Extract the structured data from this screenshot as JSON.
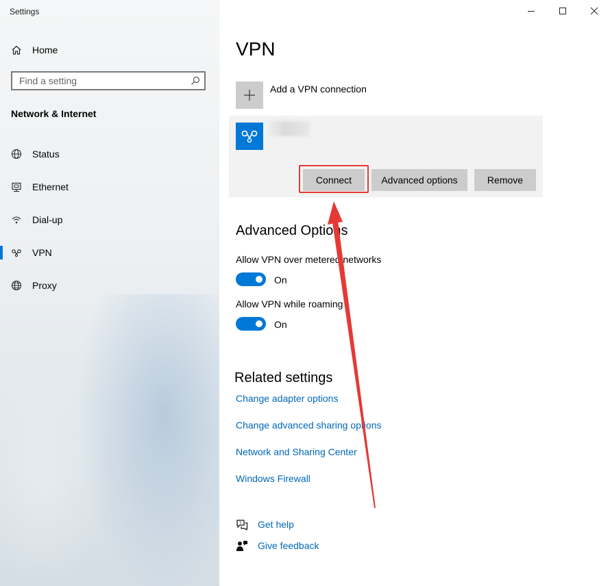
{
  "window": {
    "title": "Settings",
    "controls": [
      "minimize-icon",
      "maximize-icon",
      "close-icon"
    ]
  },
  "sidebar": {
    "home_label": "Home",
    "search_placeholder": "Find a setting",
    "section_title": "Network & Internet",
    "items": [
      {
        "label": "Status",
        "icon": "globe-icon"
      },
      {
        "label": "Ethernet",
        "icon": "ethernet-icon"
      },
      {
        "label": "Dial-up",
        "icon": "dialup-icon"
      },
      {
        "label": "VPN",
        "icon": "vpn-icon",
        "active": true
      },
      {
        "label": "Proxy",
        "icon": "globe-icon"
      }
    ]
  },
  "main": {
    "title": "VPN",
    "add_vpn_label": "Add a VPN connection",
    "vpn_card": {
      "buttons": {
        "connect": "Connect",
        "advanced": "Advanced options",
        "remove": "Remove"
      }
    },
    "advanced": {
      "heading": "Advanced Options",
      "metered_label": "Allow VPN over metered networks",
      "metered_state": "On",
      "roaming_label": "Allow VPN while roaming",
      "roaming_state": "On"
    },
    "related": {
      "heading": "Related settings",
      "links": [
        "Change adapter options",
        "Change advanced sharing options",
        "Network and Sharing Center",
        "Windows Firewall"
      ]
    },
    "help": {
      "get_help": "Get help",
      "give_feedback": "Give feedback"
    }
  },
  "colors": {
    "accent": "#0078d7",
    "link": "#0067b8",
    "highlight_box": "#e53935",
    "button_bg": "#cccccc",
    "card_bg": "#f2f2f2"
  }
}
